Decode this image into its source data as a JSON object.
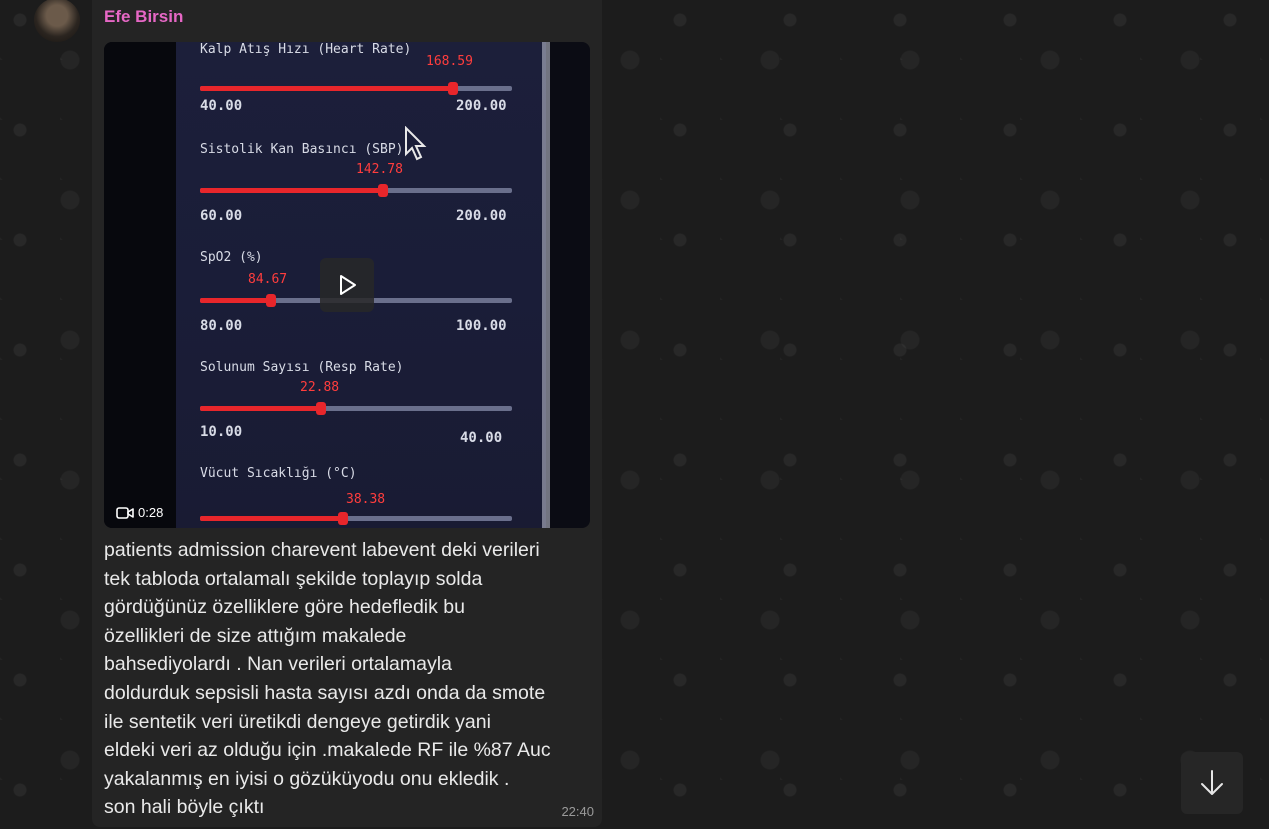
{
  "chat": {
    "sender_name": "Efe Birsin",
    "message_time": "22:40",
    "message_text": "patients admission charevent labevent deki verileri\ntek tabloda ortalamalı şekilde toplayıp solda\ngördüğünüz özelliklere göre hedefledik bu\nözellikleri de size attığım makalede\nbahsediyolardı . Nan verileri ortalamayla\ndoldurduk sepsisli hasta sayısı azdı onda da smote\nile sentetik veri üretikdi dengeye getirdik yani\neldeki veri az olduğu için .makalede RF ile %87 Auc\nyakalanmış en iyisi o gözüküyodu onu ekledik .\nson hali böyle çıktı",
    "sender_color": "#e667c5"
  },
  "video": {
    "duration": "0:28",
    "sliders": [
      {
        "label": "Kalp Atış Hızı (Heart Rate)",
        "value": "168.59",
        "min": "40.00",
        "max": "200.00",
        "fill_fraction": 0.81
      },
      {
        "label": "Sistolik Kan Basıncı (SBP)",
        "value": "142.78",
        "min": "60.00",
        "max": "200.00",
        "fill_fraction": 0.59
      },
      {
        "label": "SpO2 (%)",
        "value": "84.67",
        "min": "80.00",
        "max": "100.00",
        "fill_fraction": 0.23
      },
      {
        "label": "Solunum Sayısı (Resp Rate)",
        "value": "22.88",
        "min": "10.00",
        "max": "40.00",
        "fill_fraction": 0.43
      },
      {
        "label": "Vücut Sıcaklığı (°C)",
        "value": "38.38",
        "min": "",
        "max": "",
        "fill_fraction": 0.45
      }
    ]
  },
  "icons": {
    "play": "play-icon",
    "video_camera": "video-camera-icon",
    "scroll_down": "arrow-down-icon"
  }
}
